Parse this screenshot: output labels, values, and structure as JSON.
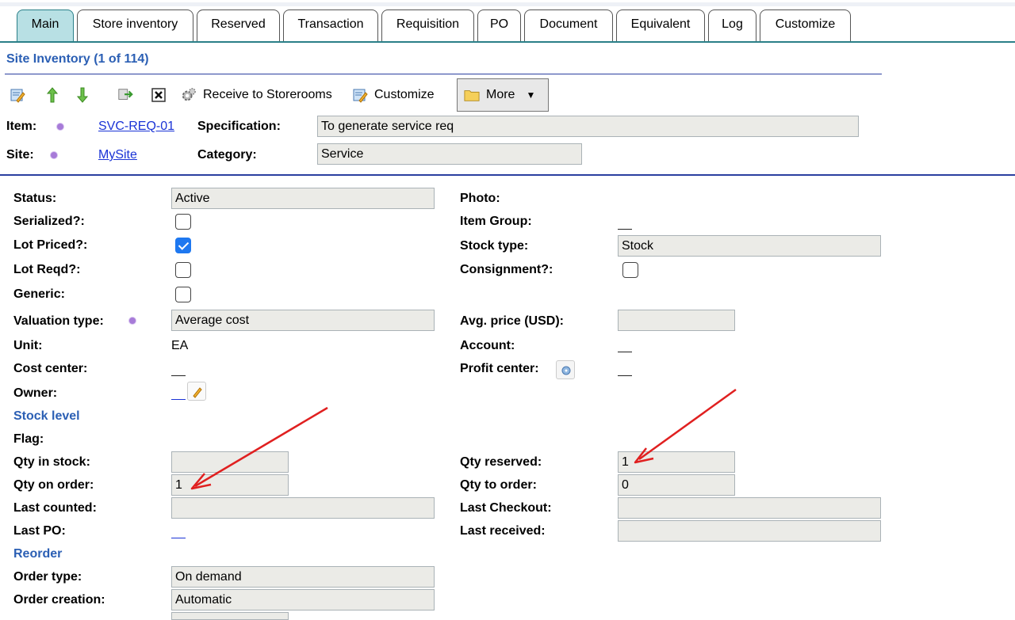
{
  "tabs": [
    "Main",
    "Store inventory",
    "Reserved",
    "Transaction",
    "Requisition",
    "PO",
    "Document",
    "Equivalent",
    "Log",
    "Customize"
  ],
  "header": {
    "title": "Site Inventory (1 of 114)"
  },
  "toolbar": {
    "receive_label": "Receive to Storerooms",
    "customize_label": "Customize",
    "more_label": "More"
  },
  "item": {
    "item_label": "Item:",
    "item_value": "SVC-REQ-01",
    "site_label": "Site:",
    "site_value": "MySite",
    "spec_label": "Specification:",
    "spec_value": "To generate service req",
    "category_label": "Category:",
    "category_value": "Service"
  },
  "left": {
    "status_label": "Status:",
    "status_value": "Active",
    "serialized_label": "Serialized?:",
    "lot_priced_label": "Lot Priced?:",
    "lot_reqd_label": "Lot Reqd?:",
    "generic_label": "Generic:",
    "valuation_label": "Valuation type:",
    "valuation_value": "Average cost",
    "unit_label": "Unit:",
    "unit_value": "EA",
    "cost_center_label": "Cost center:",
    "owner_label": "Owner:"
  },
  "right": {
    "photo_label": "Photo:",
    "item_group_label": "Item Group:",
    "stock_type_label": "Stock type:",
    "stock_type_value": "Stock",
    "consignment_label": "Consignment?:",
    "avg_price_label": "Avg. price (USD):",
    "account_label": "Account:",
    "profit_center_label": "Profit center:"
  },
  "checkboxes": {
    "serialized": false,
    "lot_priced": true,
    "lot_reqd": false,
    "generic": false,
    "consignment": false
  },
  "stock": {
    "section_label": "Stock level",
    "flag_label": "Flag:",
    "qty_in_stock_label": "Qty in stock:",
    "qty_in_stock_value": "",
    "qty_on_order_label": "Qty on order:",
    "qty_on_order_value": "1",
    "last_counted_label": "Last counted:",
    "last_po_label": "Last PO:",
    "qty_reserved_label": "Qty reserved:",
    "qty_reserved_value": "1",
    "qty_to_order_label": "Qty to order:",
    "qty_to_order_value": "0",
    "last_checkout_label": "Last Checkout:",
    "last_received_label": "Last received:"
  },
  "reorder": {
    "section_label": "Reorder",
    "order_type_label": "Order type:",
    "order_type_value": "On demand",
    "order_creation_label": "Order creation:",
    "order_creation_value": "Automatic"
  },
  "colors": {
    "tab_active": "#b8e0e4",
    "link": "#1a33d6",
    "section": "#2b5fb4",
    "field_bg": "#ebebe7",
    "arrow": "#e02020"
  }
}
